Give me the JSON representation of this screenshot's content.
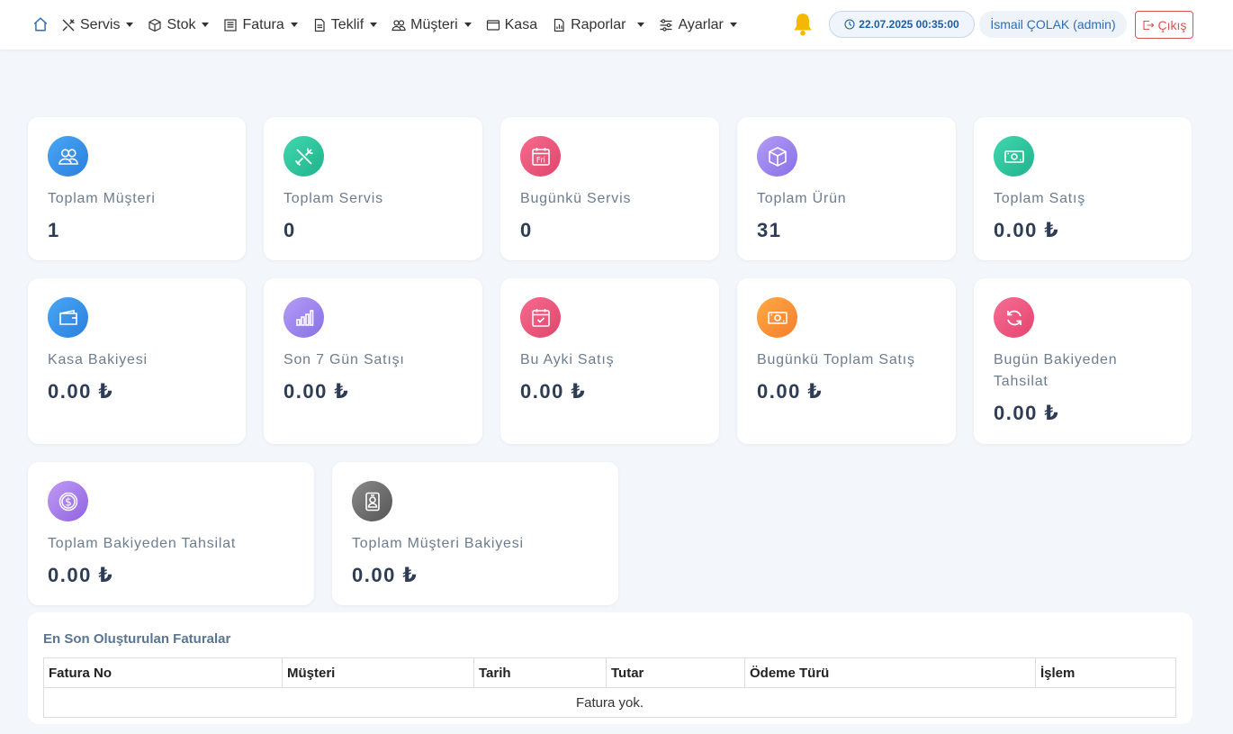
{
  "nav": {
    "menu": [
      {
        "label": "Servis",
        "icon": "tools-icon",
        "dropdown": true
      },
      {
        "label": "Stok",
        "icon": "box-icon",
        "dropdown": true
      },
      {
        "label": "Fatura",
        "icon": "invoice-icon",
        "dropdown": true
      },
      {
        "label": "Teklif",
        "icon": "document-icon",
        "dropdown": true
      },
      {
        "label": "Müşteri",
        "icon": "users-icon",
        "dropdown": true
      },
      {
        "label": "Kasa",
        "icon": "wallet-icon",
        "dropdown": false
      },
      {
        "label": "Raporlar",
        "icon": "report-icon",
        "dropdown": true
      },
      {
        "label": "Ayarlar",
        "icon": "sliders-icon",
        "dropdown": true
      }
    ],
    "datetime": "22.07.2025 00:35:00",
    "user": "İsmail ÇOLAK (admin)",
    "logout_label": "Çıkış",
    "bell_color": "#f5b800"
  },
  "cards": [
    {
      "label": "Toplam Müşteri",
      "value": "1",
      "icon": "users-icon"
    },
    {
      "label": "Toplam Servis",
      "value": "0",
      "icon": "tools-icon"
    },
    {
      "label": "Bugünkü Servis",
      "value": "0",
      "icon": "calendar-day-icon",
      "icon_text": "Fri"
    },
    {
      "label": "Toplam Ürün",
      "value": "31",
      "icon": "box-icon"
    },
    {
      "label": "Toplam Satış",
      "value": "0.00 ₺",
      "icon": "cash-icon"
    },
    {
      "label": "Kasa Bakiyesi",
      "value": "0.00 ₺",
      "icon": "wallet-icon"
    },
    {
      "label": "Son 7 Gün Satışı",
      "value": "0.00 ₺",
      "icon": "bar-chart-icon"
    },
    {
      "label": "Bu Ayki Satış",
      "value": "0.00 ₺",
      "icon": "calendar-check-icon"
    },
    {
      "label": "Bugünkü Toplam Satış",
      "value": "0.00 ₺",
      "icon": "cash-icon"
    },
    {
      "label": "Bugün Bakiyeden Tahsilat",
      "value": "0.00 ₺",
      "icon": "refresh-icon"
    },
    {
      "label": "Toplam Bakiyeden Tahsilat",
      "value": "0.00 ₺",
      "icon": "dollar-circle-icon"
    },
    {
      "label": "Toplam Müşteri Bakiyesi",
      "value": "0.00 ₺",
      "icon": "person-badge-icon"
    }
  ],
  "invoices": {
    "title": "En Son Oluşturulan Faturalar",
    "columns": [
      "Fatura No",
      "Müşteri",
      "Tarih",
      "Tutar",
      "Ödeme Türü",
      "İşlem"
    ],
    "empty_text": "Fatura yok."
  },
  "colors": {
    "accent_blue": "#1b5fa8",
    "logout_red": "#d9534f",
    "card_value": "#2e3d55",
    "card_label": "#6d7d90"
  }
}
